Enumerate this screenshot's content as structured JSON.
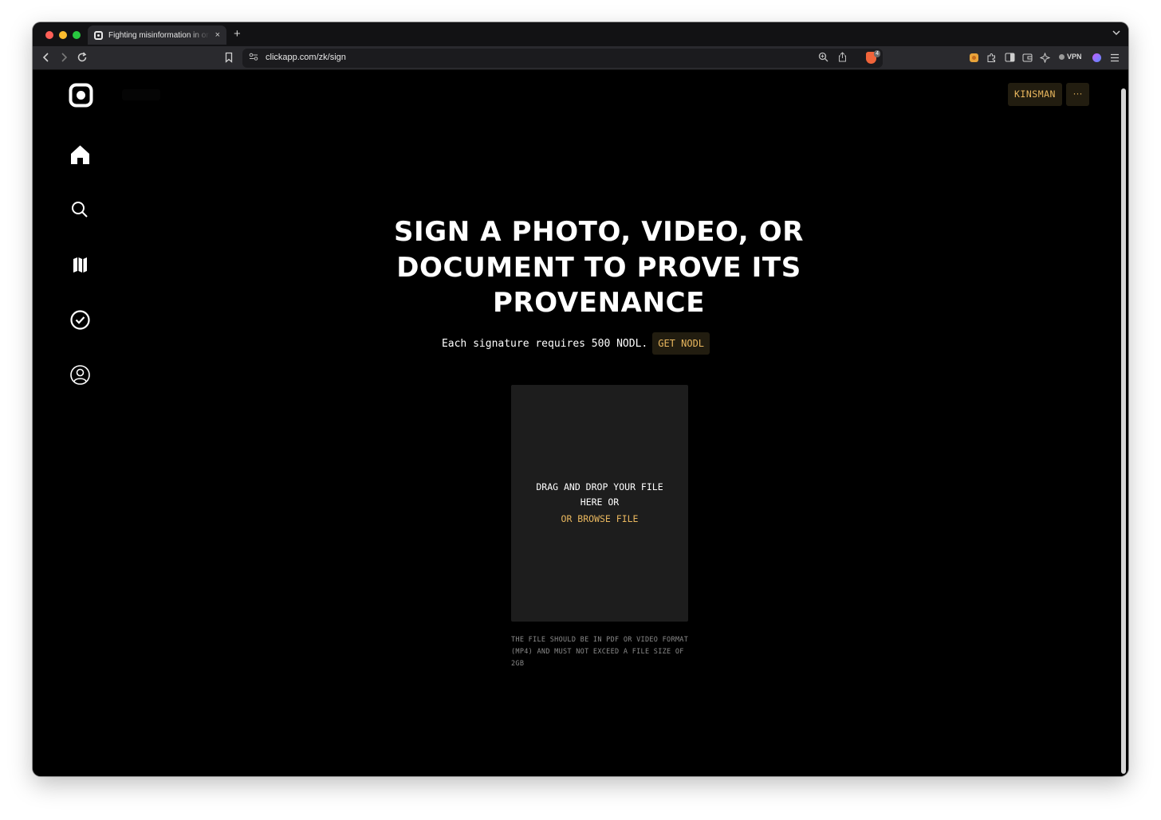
{
  "browser": {
    "tab_title": "Fighting misinformation in one",
    "tab_close": "×",
    "new_tab": "+",
    "url": "clickapp.com/zk/sign",
    "shield_count": "4",
    "vpn_label": "VPN",
    "colors": {
      "window_bg": "#121214",
      "toolbar_bg": "#2a2a2e",
      "shield": "#f0643a"
    }
  },
  "sidebar": {
    "items": [
      {
        "name": "home",
        "icon": "home-icon"
      },
      {
        "name": "search",
        "icon": "search-icon"
      },
      {
        "name": "map",
        "icon": "map-icon"
      },
      {
        "name": "verify",
        "icon": "check-circle-icon"
      },
      {
        "name": "profile",
        "icon": "user-circle-icon"
      }
    ]
  },
  "header": {
    "user_label": "KINSMAN",
    "more_label": "···"
  },
  "main": {
    "headline": "SIGN A PHOTO, VIDEO, OR DOCUMENT TO PROVE ITS PROVENANCE",
    "requirement_text": "Each signature requires 500 NODL.",
    "get_button": "GET NODL",
    "dropzone_text": "DRAG AND DROP YOUR FILE HERE OR",
    "browse_label": "OR BROWSE FILE",
    "file_note": "THE FILE SHOULD BE IN PDF OR VIDEO FORMAT (MP4) AND MUST NOT EXCEED A FILE SIZE OF 2GB"
  },
  "theme": {
    "accent": "#e9b75e",
    "accent_bg": "#221d10",
    "page_bg": "#000000",
    "dropzone_bg": "#1d1d1d"
  }
}
